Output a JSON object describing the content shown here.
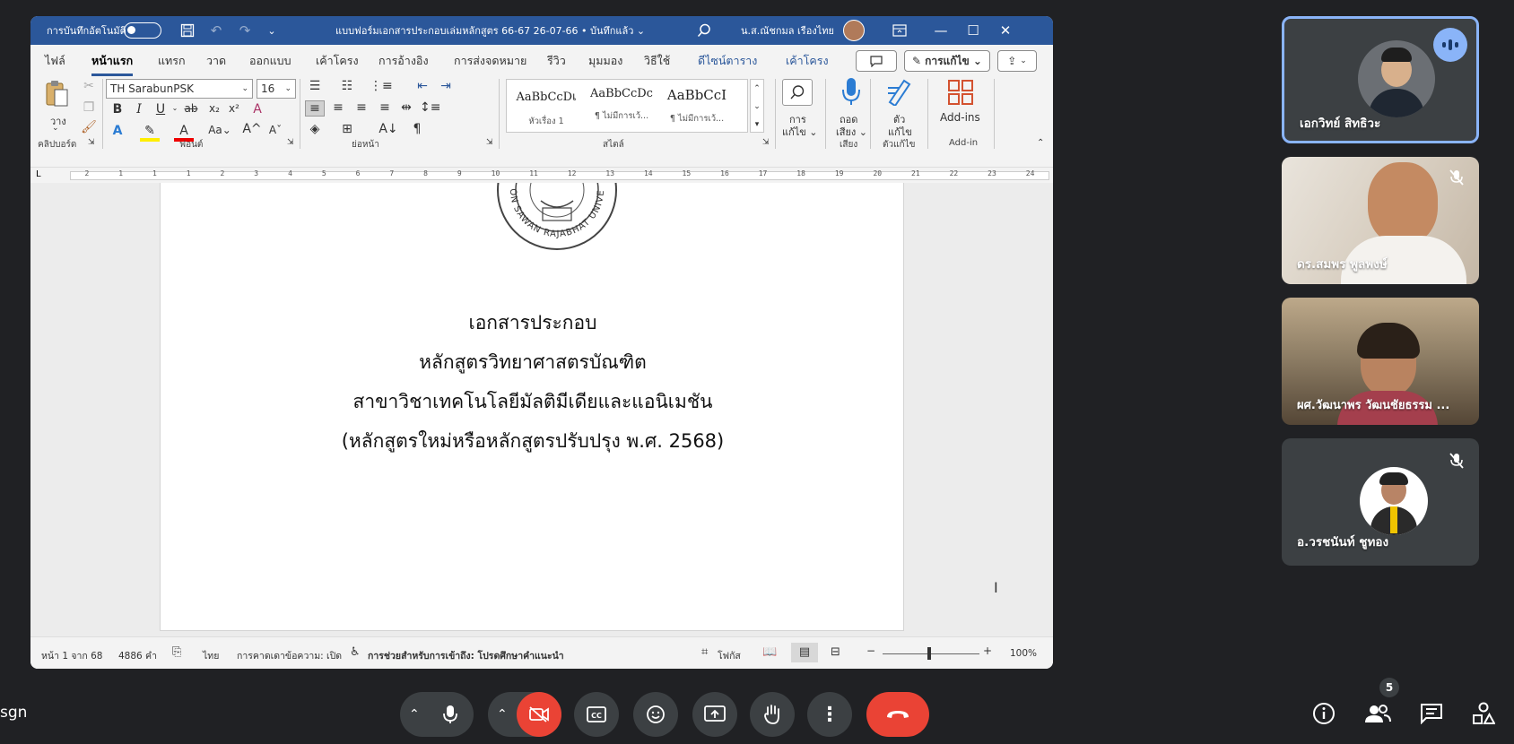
{
  "meeting": {
    "left_label": "sgn",
    "people_count": "5",
    "participants": [
      {
        "name": "เอกวิทย์ สิทธิวะ",
        "active_speaker": true
      },
      {
        "name": "ดร.สมพร พูลพงษ์",
        "muted": true
      },
      {
        "name": "ผศ.วัฒนาพร วัฒนชัยธรรม ...",
        "muted": false
      },
      {
        "name": "อ.วรชนันท์ ชูทอง",
        "muted": true
      }
    ]
  },
  "word": {
    "autosave_label": "การบันทึกอัตโนมัติ",
    "doc_title": "แบบฟอร์มเอกสารประกอบเล่มหลักสูตร 66-67 26-07-66 • บันทึกแล้ว ⌄",
    "user_name": "น.ส.ณัชกมล เรืองไทย",
    "menu": [
      {
        "label": "ไฟล์"
      },
      {
        "label": "หน้าแรก",
        "active": true
      },
      {
        "label": "แทรก"
      },
      {
        "label": "วาด"
      },
      {
        "label": "ออกแบบ"
      },
      {
        "label": "เค้าโครง"
      },
      {
        "label": "การอ้างอิง"
      },
      {
        "label": "การส่งจดหมาย"
      },
      {
        "label": "รีวิว"
      },
      {
        "label": "มุมมอง"
      },
      {
        "label": "วิธีใช้"
      },
      {
        "label": "ดีไซน์ตาราง",
        "accent": true
      },
      {
        "label": "เค้าโครง",
        "accent": true
      }
    ],
    "editing_label": "การแก้ไข ⌄",
    "ribbon": {
      "paste_label": "วาง",
      "font_name": "TH SarabunPSK",
      "font_size": "16",
      "styles": [
        {
          "preview": "AaBbCcDเ",
          "name": "หัวเรื่อง 1"
        },
        {
          "preview": "AaBbCcDc",
          "name": "¶ ไม่มีการเว้..."
        },
        {
          "preview": "AaBbCcI",
          "name": "¶ ไม่มีการเว้..."
        }
      ],
      "edit_label_1": "การ",
      "edit_label_2": "แก้ไข ⌄",
      "dictate_label_1": "ถอด",
      "dictate_label_2": "เสียง ⌄",
      "editor_label_1": "ตัว",
      "editor_label_2": "แก้ไข",
      "addins_label": "Add-ins",
      "groups": {
        "clipboard": "คลิปบอร์ด",
        "font": "ฟอนต์",
        "paragraph": "ย่อหน้า",
        "styles": "สไตล์",
        "voice": "เสียง",
        "editor": "ตัวแก้ไข",
        "addins": "Add-in"
      }
    },
    "ruler_numbers": [
      "2",
      "1",
      "1",
      "1",
      "2",
      "3",
      "4",
      "5",
      "6",
      "7",
      "8",
      "9",
      "10",
      "11",
      "12",
      "13",
      "14",
      "15",
      "16",
      "17",
      "18",
      "19",
      "20",
      "21",
      "22",
      "23",
      "24"
    ],
    "seal_text": "NAKHON SAWAN RAJABHAT UNIVERSITY",
    "document_lines": [
      "เอกสารประกอบ",
      "หลักสูตรวิทยาศาสตรบัณฑิต",
      "สาขาวิชาเทคโนโลยีมัลติมีเดียและแอนิเมชัน",
      "(หลักสูตรใหม่หรือหลักสูตรปรับปรุง พ.ศ. 2568)"
    ],
    "status": {
      "page": "หน้า 1 จาก 68",
      "words": "4886 คำ",
      "language": "ไทย",
      "prediction": "การคาดเดาข้อความ: เปิด",
      "accessibility": "การช่วยสำหรับการเข้าถึง: โปรดศึกษาคำแนะนำ",
      "focus": "โฟกัส",
      "zoom": "100%"
    }
  }
}
